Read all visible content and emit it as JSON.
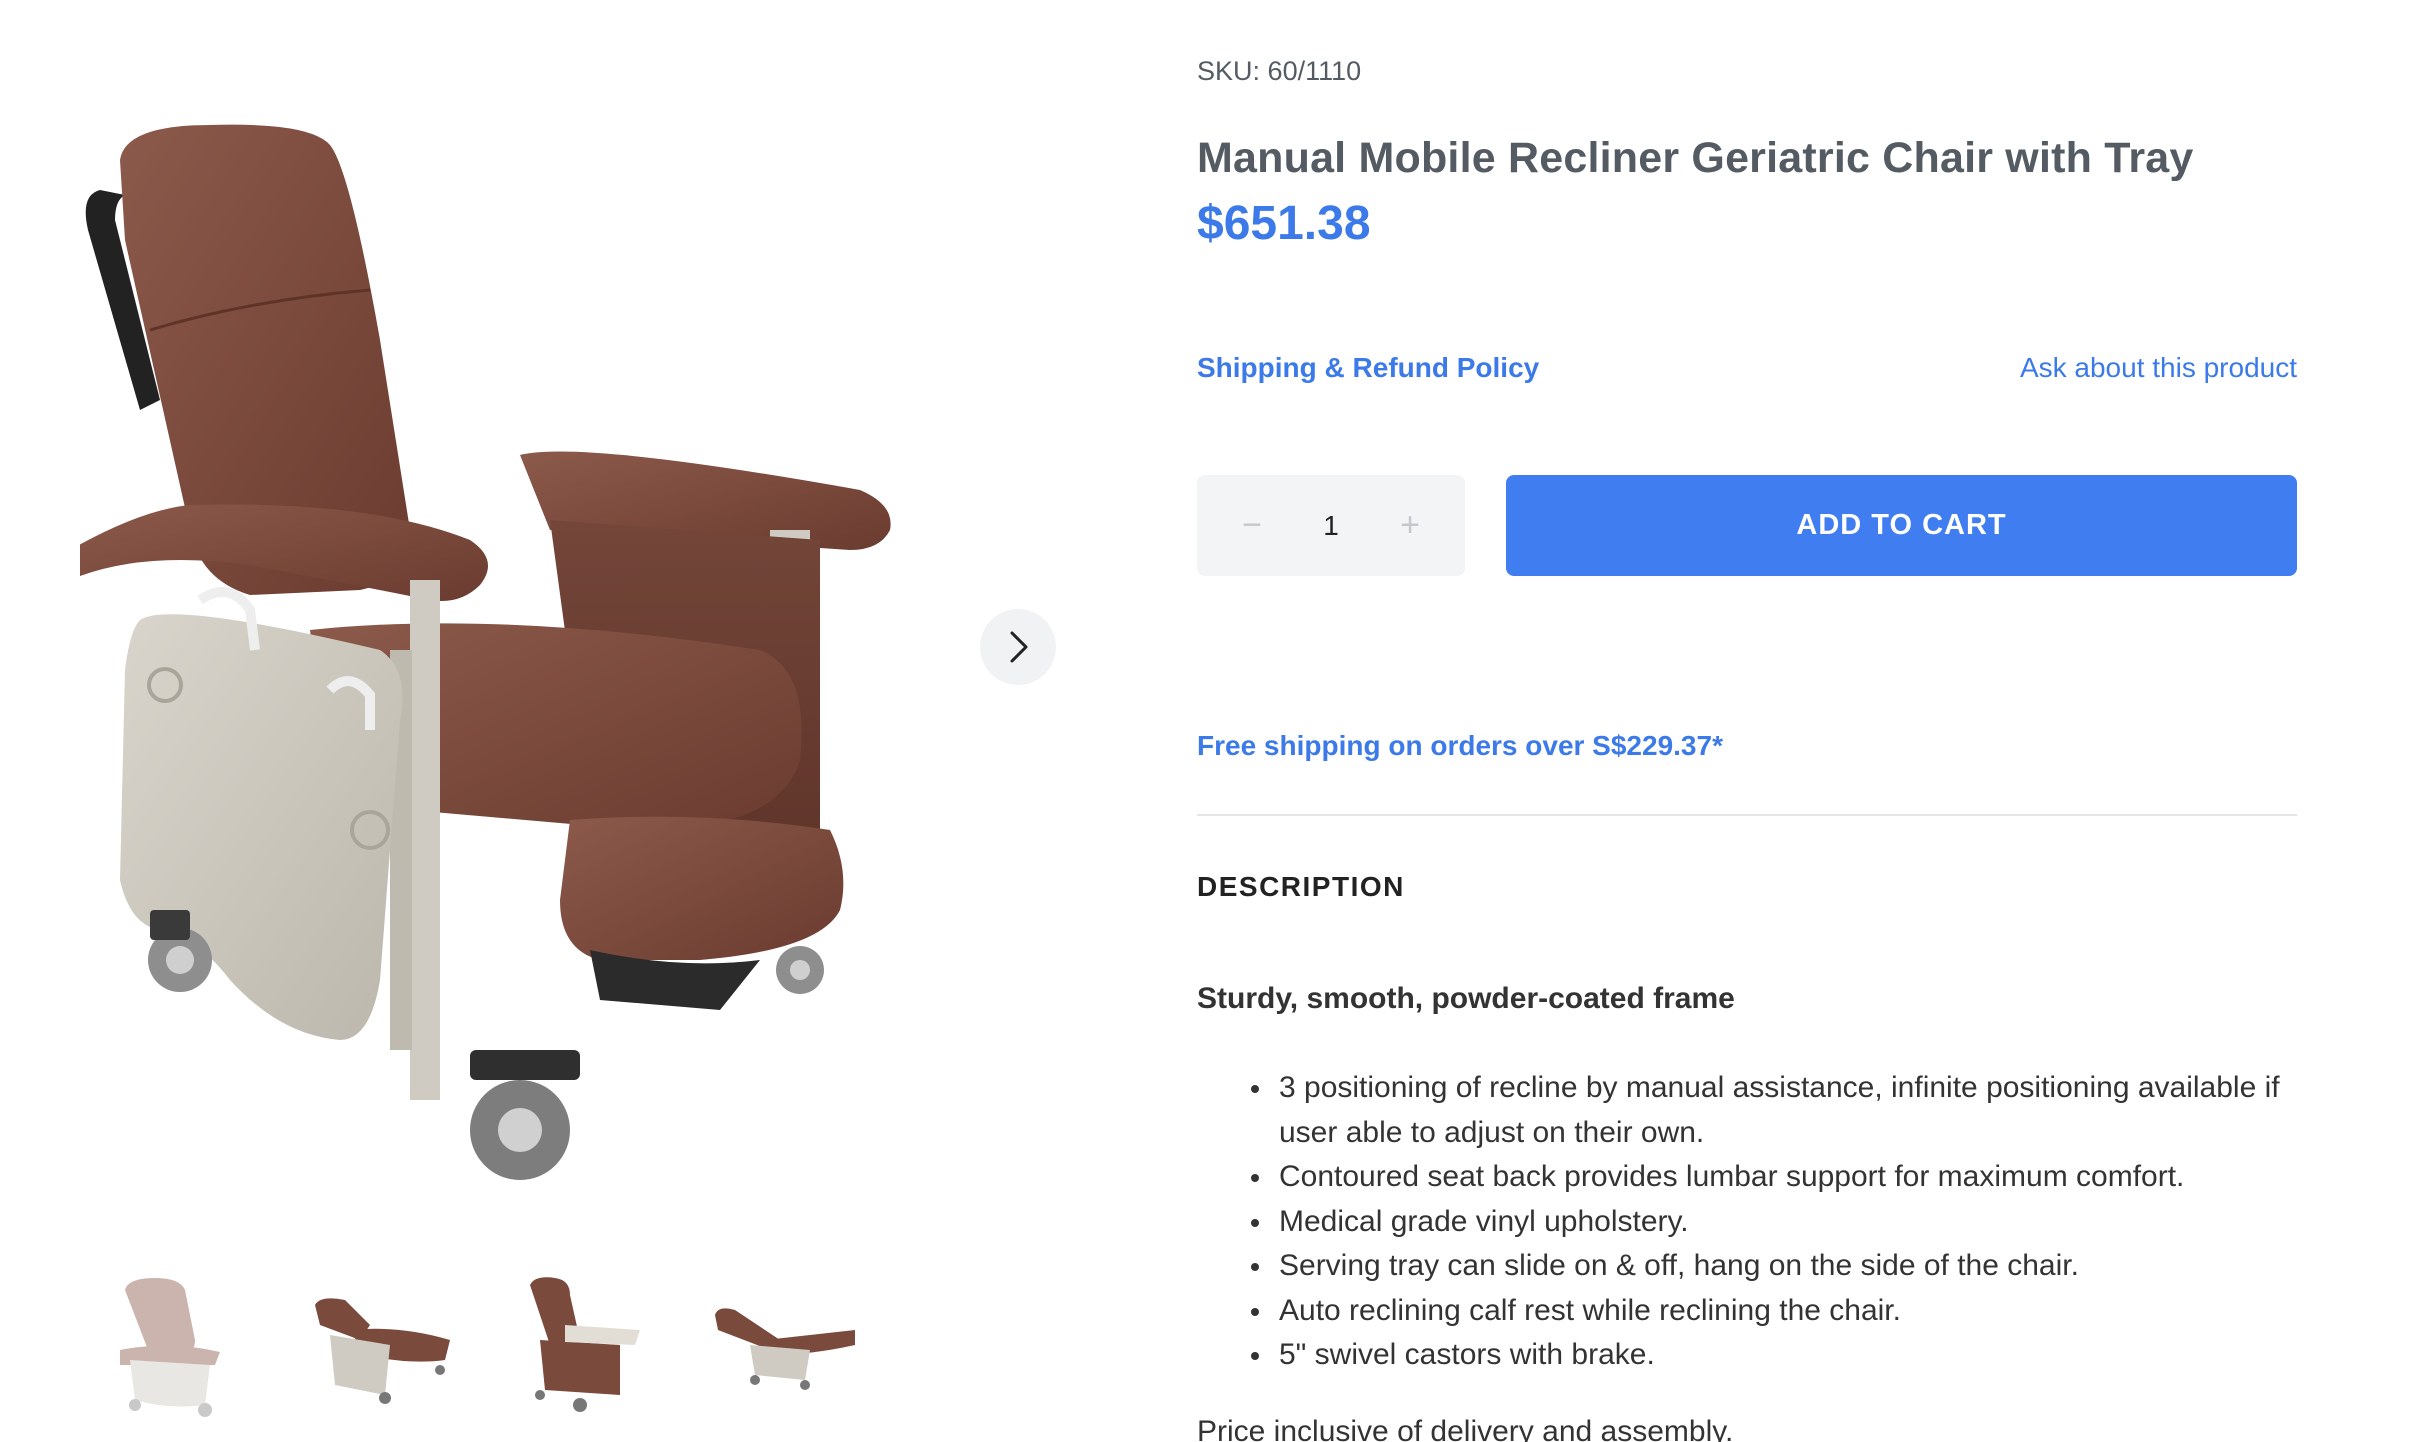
{
  "product": {
    "sku_label": "SKU:",
    "sku_value": "60/1110",
    "title": "Manual Mobile Recliner Geriatric Chair with Tray",
    "price": "$651.38",
    "image_alt": "Brown manual mobile recliner geriatric chair"
  },
  "links": {
    "shipping_policy": "Shipping & Refund Policy",
    "ask_product": "Ask about this product"
  },
  "purchase": {
    "quantity": "1",
    "minus_symbol": "−",
    "plus_symbol": "+",
    "add_to_cart": "ADD TO CART"
  },
  "shipping_notice": "Free shipping on orders over S$229.37*",
  "description": {
    "heading": "DESCRIPTION",
    "subheading": "Sturdy, smooth, powder-coated frame",
    "features": [
      "3 positioning of recline by manual assistance, infinite positioning available if user able to adjust on their own.",
      "Contoured seat back provides lumbar support for maximum comfort.",
      "Medical grade vinyl upholstery.",
      "Serving tray can slide on & off, hang on the side of the chair.",
      "Auto reclining calf rest while reclining the chair.",
      "5\" swivel castors with brake."
    ],
    "price_note": "Price inclusive of delivery and assembly."
  },
  "gallery": {
    "thumbnail_count": 4,
    "active_thumbnail": 1,
    "next_icon": "chevron-right-icon"
  },
  "colors": {
    "accent": "#3f7df0",
    "link": "#3b7ae8",
    "chair_upholstery": "#7a4a3c",
    "frame": "#cfcbc2"
  }
}
